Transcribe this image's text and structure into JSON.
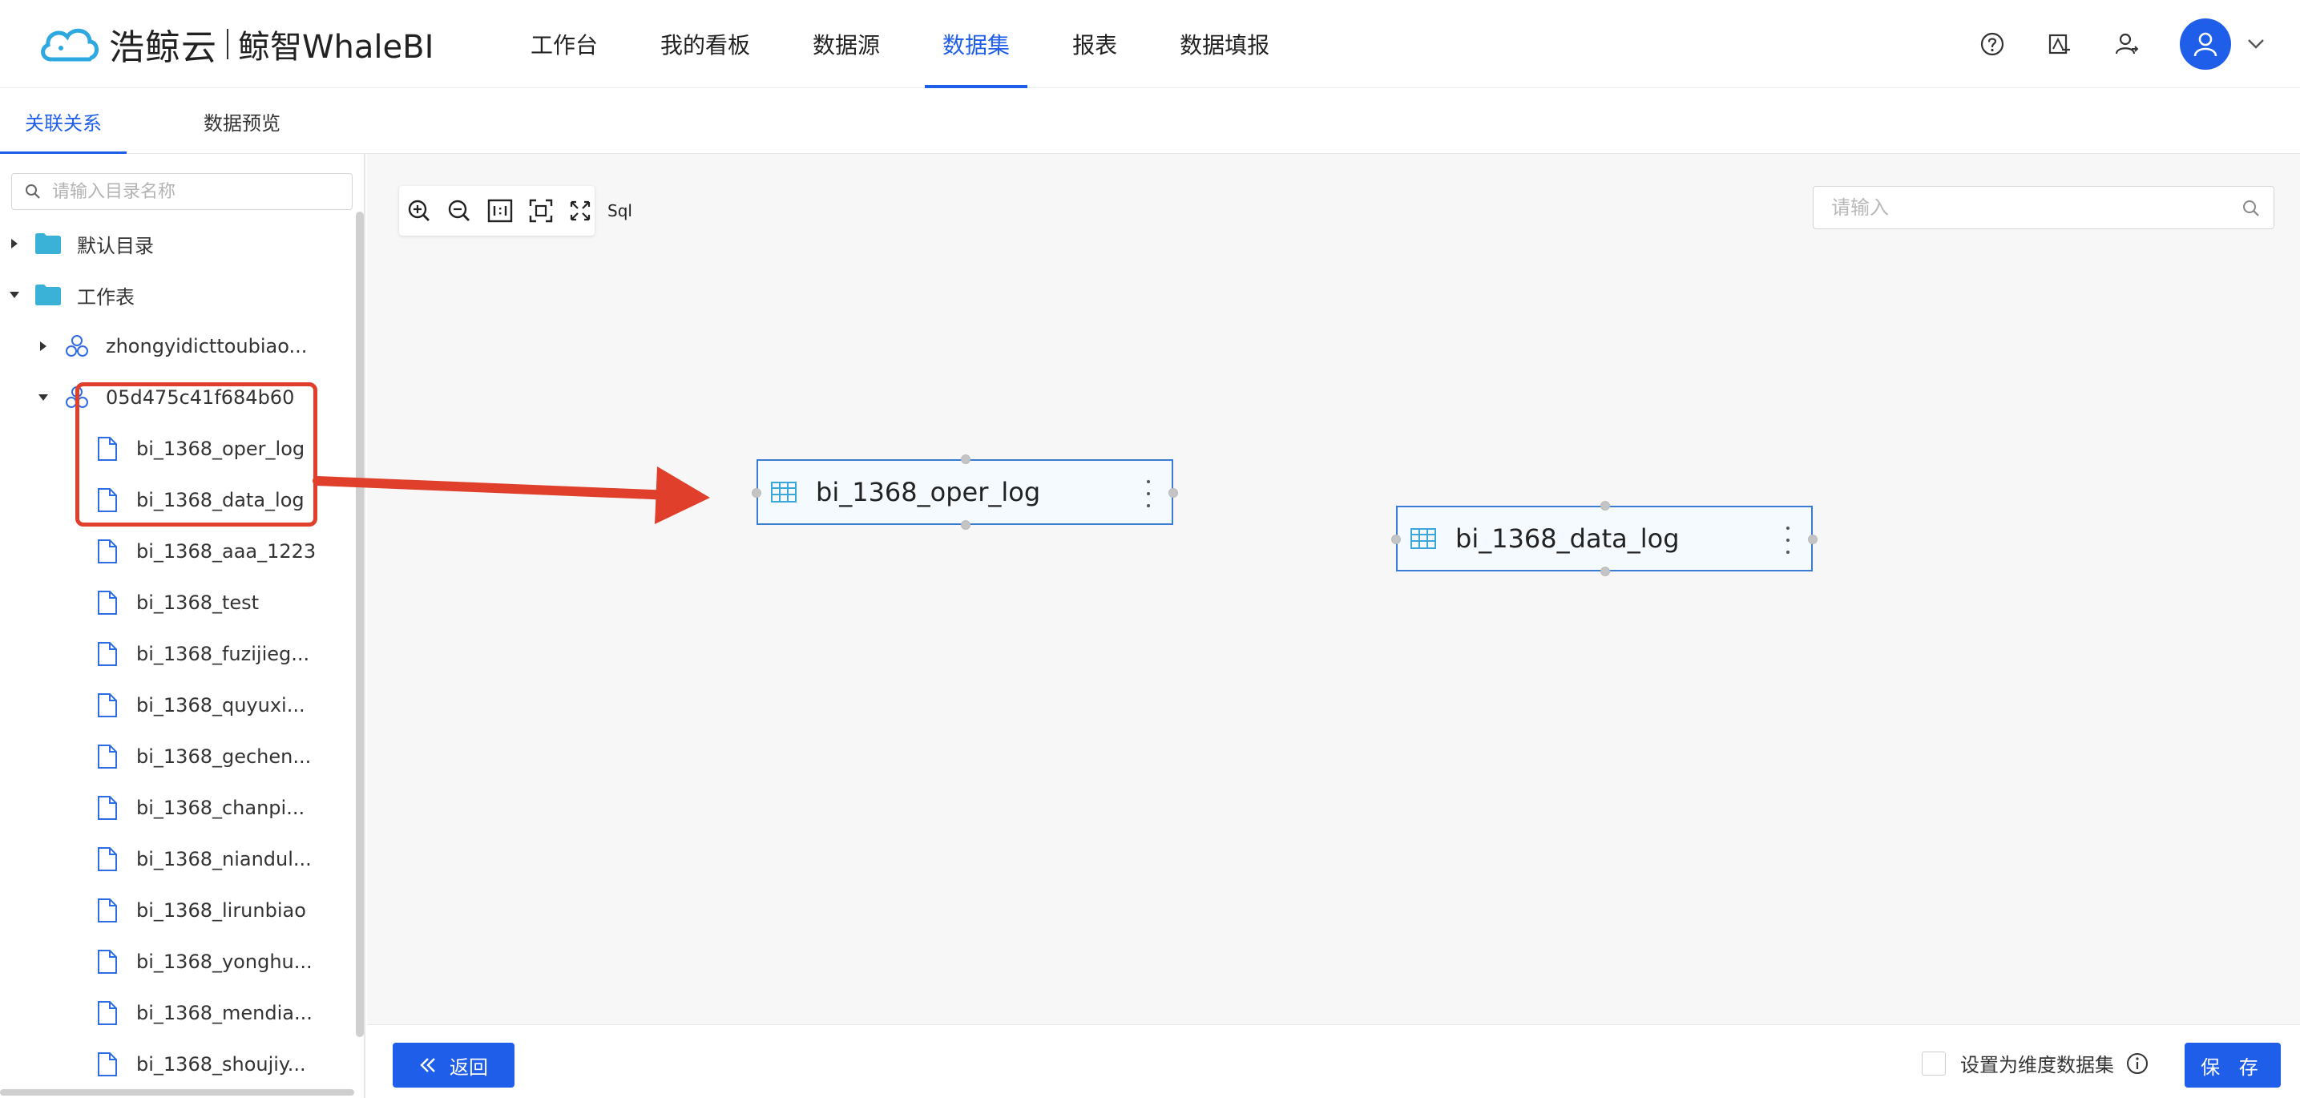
{
  "brand": {
    "name": "浩鲸云",
    "product": "鲸智WhaleBI"
  },
  "nav": {
    "items": [
      {
        "label": "工作台",
        "active": false
      },
      {
        "label": "我的看板",
        "active": false
      },
      {
        "label": "数据源",
        "active": false
      },
      {
        "label": "数据集",
        "active": true
      },
      {
        "label": "报表",
        "active": false
      },
      {
        "label": "数据填报",
        "active": false
      }
    ]
  },
  "header_icons": [
    "help-icon",
    "assign-icon",
    "user-switch-icon",
    "user-avatar",
    "chevron-down-icon"
  ],
  "subtabs": [
    {
      "label": "关联关系",
      "active": true
    },
    {
      "label": "数据预览",
      "active": false
    }
  ],
  "sidebar": {
    "search_placeholder": "请输入目录名称",
    "tree": [
      {
        "label": "默认目录",
        "type": "folder",
        "level": 0,
        "expanded": false
      },
      {
        "label": "工作表",
        "type": "folder",
        "level": 0,
        "expanded": true
      },
      {
        "label": "zhongyidicttoubiao...",
        "type": "datasource",
        "level": 1,
        "expanded": false
      },
      {
        "label": "05d475c41f684b60",
        "type": "datasource",
        "level": 1,
        "expanded": true
      },
      {
        "label": "bi_1368_oper_log",
        "type": "file",
        "level": 2
      },
      {
        "label": "bi_1368_data_log",
        "type": "file",
        "level": 2
      },
      {
        "label": "bi_1368_aaa_1223",
        "type": "file",
        "level": 2
      },
      {
        "label": "bi_1368_test",
        "type": "file",
        "level": 2
      },
      {
        "label": "bi_1368_fuzijieg...",
        "type": "file",
        "level": 2
      },
      {
        "label": "bi_1368_quyuxi...",
        "type": "file",
        "level": 2
      },
      {
        "label": "bi_1368_gechen...",
        "type": "file",
        "level": 2
      },
      {
        "label": "bi_1368_chanpi...",
        "type": "file",
        "level": 2
      },
      {
        "label": "bi_1368_niandul...",
        "type": "file",
        "level": 2
      },
      {
        "label": "bi_1368_lirunbiao",
        "type": "file",
        "level": 2
      },
      {
        "label": "bi_1368_yonghu...",
        "type": "file",
        "level": 2
      },
      {
        "label": "bi_1368_mendia...",
        "type": "file",
        "level": 2
      },
      {
        "label": "bi_1368_shoujiy...",
        "type": "file",
        "level": 2
      }
    ]
  },
  "canvas": {
    "toolbar": {
      "tools": [
        "zoom-in-icon",
        "zoom-out-icon",
        "actual-size-icon",
        "fit-view-icon",
        "fullscreen-icon"
      ],
      "sql_label": "Sql"
    },
    "search_placeholder": "请输入",
    "nodes": [
      {
        "label": "bi_1368_oper_log"
      },
      {
        "label": "bi_1368_data_log"
      }
    ]
  },
  "footer": {
    "back_label": "返回",
    "dimension_label": "设置为维度数据集",
    "dimension_checked": false,
    "save_label": "保 存"
  },
  "colors": {
    "accent": "#1f5ee9",
    "highlight": "#e0402b",
    "node_border": "#3a7bd5",
    "folder": "#3ab2d8"
  }
}
